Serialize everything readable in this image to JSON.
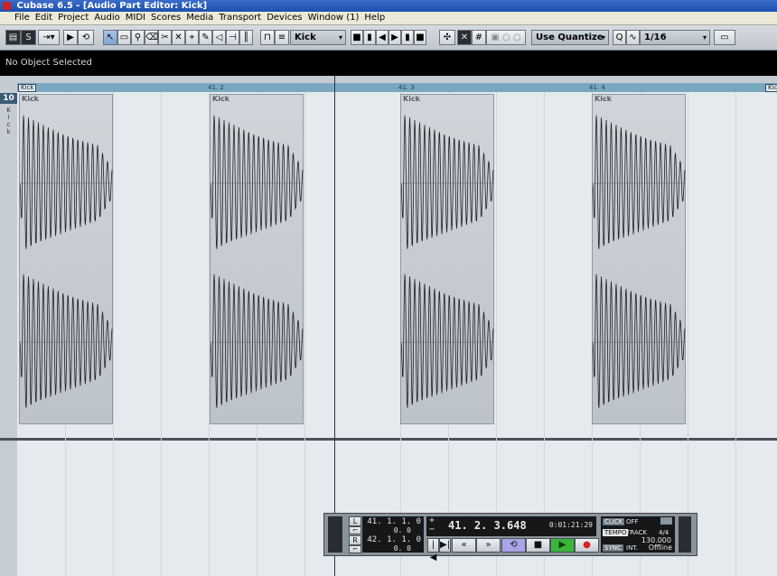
{
  "window": {
    "title": "Cubase 6.5 - [Audio Part Editor: Kick]"
  },
  "menu": [
    "File",
    "Edit",
    "Project",
    "Audio",
    "MIDI",
    "Scores",
    "Media",
    "Transport",
    "Devices",
    "Window (1)",
    "Help"
  ],
  "toolbar": {
    "display_dropdown": "Kick",
    "quantize_dropdown": "Use Quantize",
    "quantize_value": "1/16"
  },
  "infoline": {
    "text": "No Object Selected"
  },
  "ruler": {
    "start_flag": "Kick",
    "end_flag": "Kick",
    "positions": [
      "41. 2",
      "41. 3",
      "41. 4"
    ]
  },
  "track": {
    "number": "10",
    "name_vertical": "Kick"
  },
  "events": [
    {
      "name": "Kick"
    },
    {
      "name": "Kick"
    },
    {
      "name": "Kick"
    },
    {
      "name": "Kick"
    }
  ],
  "transport": {
    "left_locator": "41.  1.  1.  0",
    "left_sub": "0.  0",
    "right_locator": "42.  1.  1.  0",
    "right_sub": "0.  0",
    "L": "L",
    "R": "R",
    "position_primary": "41.  2.  3.648",
    "position_secondary": "0:01:21:29",
    "click_label": "CLICK",
    "click_state": "OFF",
    "tempo_label": "TEMPO",
    "track_label": "TRACK",
    "signature": "4/4",
    "tempo_value": "130.000",
    "sync_label": "SYNC",
    "int_label": "INT.",
    "offline": "Offline"
  },
  "colors": {
    "ruler": "#7aa7c0",
    "play": "#3ab53a",
    "record": "#d02020",
    "cycle": "#a8a4e8"
  }
}
